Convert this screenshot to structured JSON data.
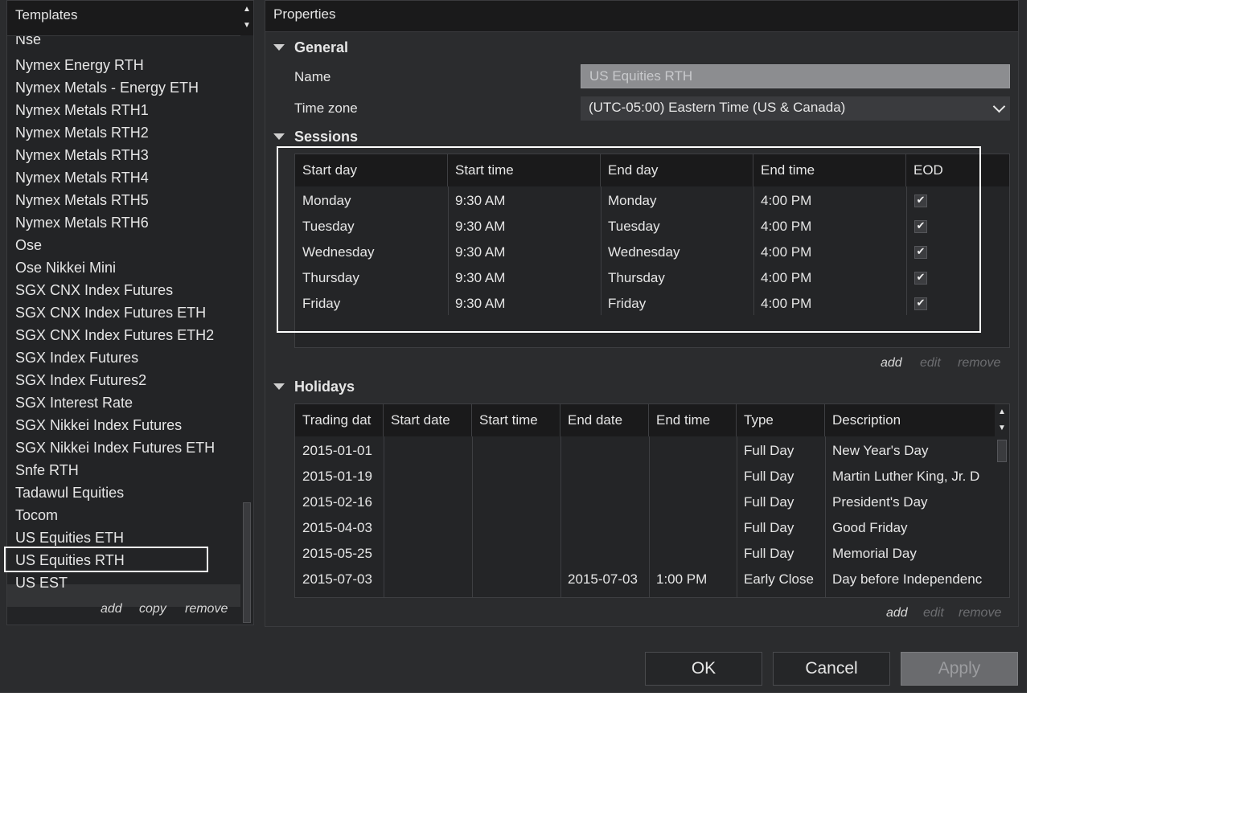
{
  "templates": {
    "title": "Templates",
    "partial_item": "Nse",
    "items": [
      "Nymex Energy RTH",
      "Nymex Metals - Energy ETH",
      "Nymex Metals RTH1",
      "Nymex Metals RTH2",
      "Nymex Metals RTH3",
      "Nymex Metals RTH4",
      "Nymex Metals RTH5",
      "Nymex Metals RTH6",
      "Ose",
      "Ose Nikkei Mini",
      "SGX CNX Index Futures",
      "SGX CNX Index Futures ETH",
      "SGX CNX Index Futures ETH2",
      "SGX Index Futures",
      "SGX Index Futures2",
      "SGX Interest Rate",
      "SGX Nikkei Index Futures",
      "SGX Nikkei Index Futures ETH",
      "Snfe RTH",
      "Tadawul Equities",
      "Tocom",
      "US Equities ETH",
      "US Equities RTH",
      "US EST"
    ],
    "selected": "US Equities RTH",
    "actions": {
      "add": "add",
      "copy": "copy",
      "remove": "remove"
    }
  },
  "properties": {
    "title": "Properties",
    "general": {
      "title": "General",
      "name_label": "Name",
      "name_value": "US Equities RTH",
      "timezone_label": "Time zone",
      "timezone_value": "(UTC-05:00) Eastern Time (US & Canada)"
    },
    "sessions": {
      "title": "Sessions",
      "columns": [
        "Start day",
        "Start time",
        "End day",
        "End time",
        "EOD"
      ],
      "rows": [
        {
          "start_day": "Monday",
          "start_time": "9:30 AM",
          "end_day": "Monday",
          "end_time": "4:00 PM",
          "eod": true
        },
        {
          "start_day": "Tuesday",
          "start_time": "9:30 AM",
          "end_day": "Tuesday",
          "end_time": "4:00 PM",
          "eod": true
        },
        {
          "start_day": "Wednesday",
          "start_time": "9:30 AM",
          "end_day": "Wednesday",
          "end_time": "4:00 PM",
          "eod": true
        },
        {
          "start_day": "Thursday",
          "start_time": "9:30 AM",
          "end_day": "Thursday",
          "end_time": "4:00 PM",
          "eod": true
        },
        {
          "start_day": "Friday",
          "start_time": "9:30 AM",
          "end_day": "Friday",
          "end_time": "4:00 PM",
          "eod": true
        }
      ],
      "actions": {
        "add": "add",
        "edit": "edit",
        "remove": "remove"
      }
    },
    "holidays": {
      "title": "Holidays",
      "columns": [
        "Trading dat",
        "Start date",
        "Start time",
        "End date",
        "End time",
        "Type",
        "Description"
      ],
      "rows": [
        {
          "trading_date": "2015-01-01",
          "start_date": "",
          "start_time": "",
          "end_date": "",
          "end_time": "",
          "type": "Full Day",
          "description": "New Year's Day"
        },
        {
          "trading_date": "2015-01-19",
          "start_date": "",
          "start_time": "",
          "end_date": "",
          "end_time": "",
          "type": "Full Day",
          "description": "Martin Luther King, Jr. D"
        },
        {
          "trading_date": "2015-02-16",
          "start_date": "",
          "start_time": "",
          "end_date": "",
          "end_time": "",
          "type": "Full Day",
          "description": "President's Day"
        },
        {
          "trading_date": "2015-04-03",
          "start_date": "",
          "start_time": "",
          "end_date": "",
          "end_time": "",
          "type": "Full Day",
          "description": "Good Friday"
        },
        {
          "trading_date": "2015-05-25",
          "start_date": "",
          "start_time": "",
          "end_date": "",
          "end_time": "",
          "type": "Full Day",
          "description": "Memorial Day"
        },
        {
          "trading_date": "2015-07-03",
          "start_date": "",
          "start_time": "",
          "end_date": "2015-07-03",
          "end_time": "1:00 PM",
          "type": "Early Close",
          "description": "Day before Independenc"
        }
      ],
      "actions": {
        "add": "add",
        "edit": "edit",
        "remove": "remove"
      }
    }
  },
  "buttons": {
    "ok": "OK",
    "cancel": "Cancel",
    "apply": "Apply"
  }
}
